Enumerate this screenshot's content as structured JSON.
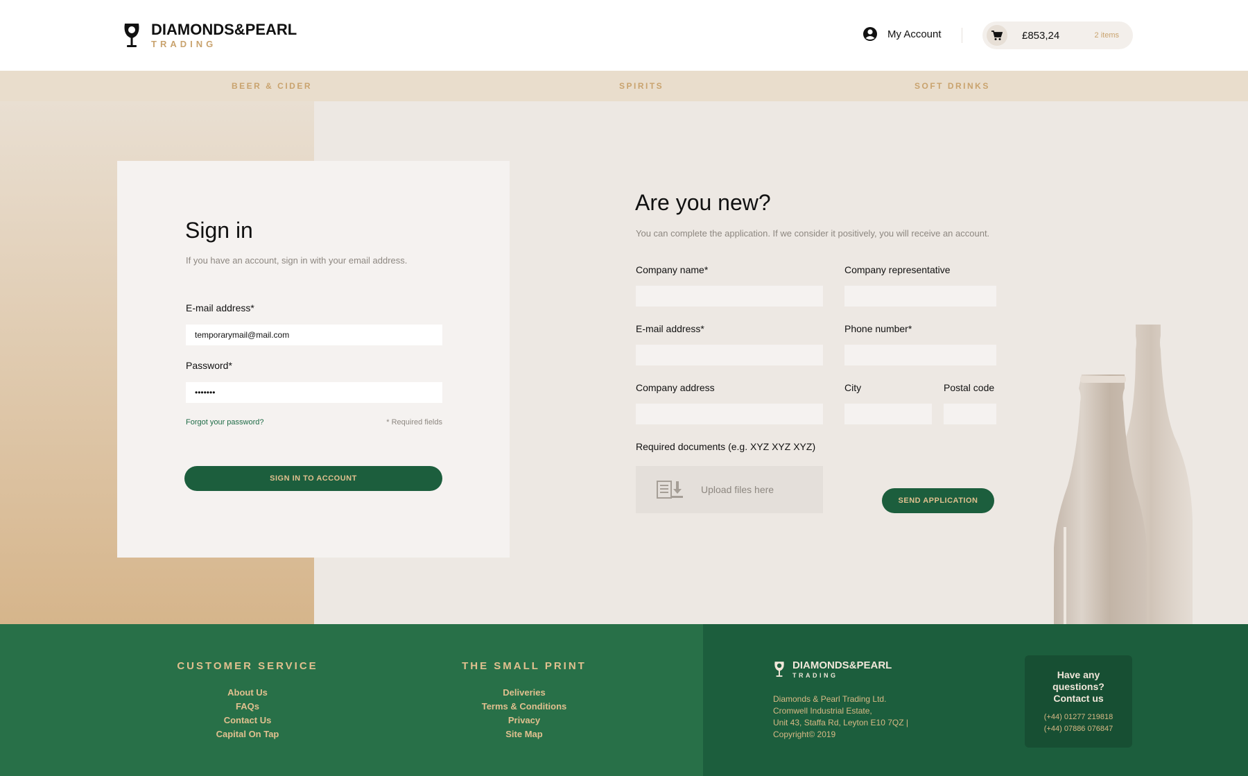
{
  "header": {
    "logo_name": "DIAMONDS&PEARL",
    "logo_sub": "TRADING",
    "account_label": "My Account",
    "cart_total": "£853,24",
    "cart_items": "2 items"
  },
  "nav": {
    "items": [
      "BEER & CIDER",
      "SPIRITS",
      "SOFT DRINKS"
    ]
  },
  "signin": {
    "title": "Sign in",
    "subtitle": "If you have an account, sign in with your email address.",
    "email_label": "E-mail address*",
    "email_value": "temporarymail@mail.com",
    "password_label": "Password*",
    "password_value": "•••••••",
    "forgot_link": "Forgot your password?",
    "required_note": "* Required fields",
    "button_label": "SIGN IN TO ACCOUNT"
  },
  "register": {
    "title": "Are you new?",
    "subtitle": "You can complete the application. If we consider it positively, you will receive an account.",
    "company_name_label": "Company name*",
    "company_rep_label": "Company representative",
    "email_label": "E-mail address*",
    "phone_label": "Phone number*",
    "address_label": "Company address",
    "city_label": "City",
    "postal_label": "Postal code",
    "documents_label": "Required documents (e.g. XYZ XYZ XYZ)",
    "upload_label": "Upload files here",
    "send_button_label": "SEND APPLICATION"
  },
  "footer": {
    "customer_service": {
      "heading": "CUSTOMER SERVICE",
      "links": [
        "About Us",
        "FAQs",
        "Contact Us",
        "Capital On Tap"
      ]
    },
    "small_print": {
      "heading": "THE SMALL PRINT",
      "links": [
        "Deliveries",
        "Terms & Conditions",
        "Privacy",
        "Site Map"
      ]
    },
    "logo_name": "DIAMONDS&PEARL",
    "logo_sub": "TRADING",
    "address_lines": [
      "Diamonds & Pearl Trading Ltd.",
      "Cromwell Industrial Estate,",
      "Unit 43, Staffa Rd, Leyton E10 7QZ |",
      "Copyright© 2019"
    ],
    "contact_question": "Have any questions? Contact us",
    "phones": [
      "(+44) 01277 219818",
      "(+44) 07886 076847"
    ]
  },
  "colors": {
    "brand_green": "#1c5e3d",
    "footer_green": "#287048",
    "gold": "#c9a36e",
    "nav_bg": "#e9ddcc",
    "page_bg": "#ede8e3"
  },
  "icons": {
    "logo": "wine-glass-icon",
    "account": "user-circle-icon",
    "cart": "shopping-cart-icon",
    "upload": "upload-file-icon"
  }
}
